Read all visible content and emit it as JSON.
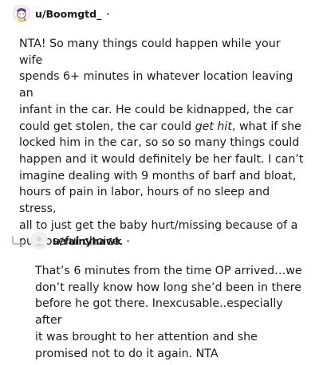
{
  "comments": [
    {
      "username": "u/Boomgtd_",
      "separator": "•",
      "avatar_icon": "snoo-avatar-icon",
      "body_lines": [
        "NTA! So many things could happen while your wife",
        "spends 6+ minutes in whatever location leaving an",
        "infant in the car. He could be kidnapped, the car",
        "could get stolen, the car could ",
        "get hit",
        ", what if she",
        "locked him in the car, so so so many things could",
        "happen and it would definitely be her fault. I can’t",
        "imagine dealing with 9 months of barf and bloat,",
        "hours of pain in labor, hours of no sleep and stress,",
        "all to just get the baby hurt/missing because of a",
        "purposeful choice."
      ]
    },
    {
      "username": "u/rainyhawk",
      "separator": "•",
      "avatar_icon": "default-avatar-icon",
      "reply_icon": "reply-arrow-icon",
      "body_lines": [
        "That’s 6 minutes from the time OP arrived…we",
        "don’t really know how long she’d been in there",
        "before he got there. Inexcusable..especially after",
        "it was brought to her attention and she",
        "promised not to do it again. NTA"
      ]
    }
  ],
  "colors": {
    "text": "#1a1a1b",
    "meta": "#7c7c7c",
    "reply_arrow": "#a5a5a5"
  }
}
